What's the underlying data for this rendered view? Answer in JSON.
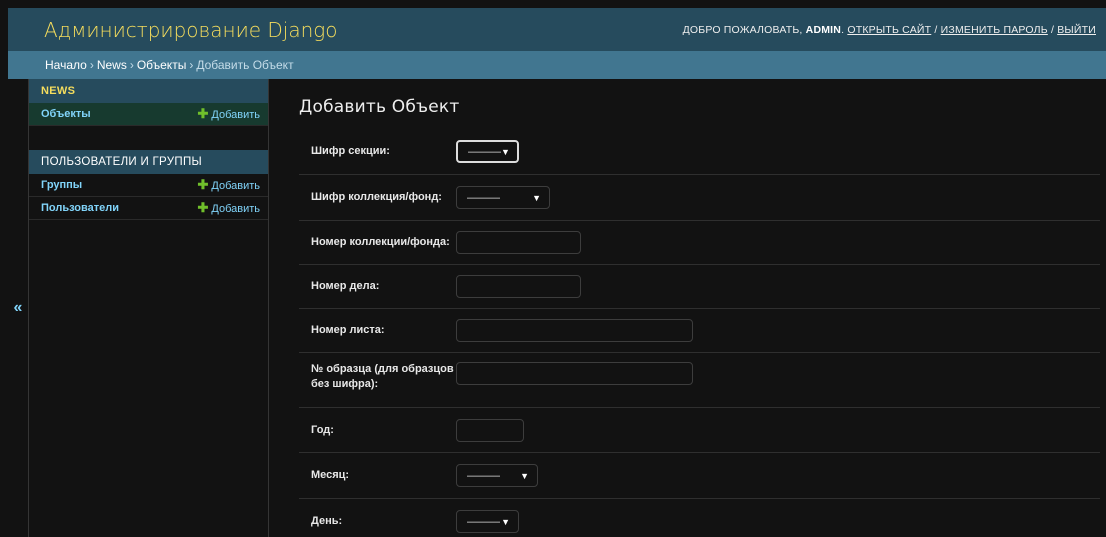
{
  "header": {
    "site_name": "Администрирование Django",
    "welcome": "ДОБРО ПОЖАЛОВАТЬ,",
    "username": "ADMIN",
    "links": [
      "ОТКРЫТЬ САЙТ",
      "ИЗМЕНИТЬ ПАРОЛЬ",
      "ВЫЙТИ"
    ],
    "separator": "/"
  },
  "breadcrumbs": {
    "items": [
      "Начало",
      "News",
      "Объекты"
    ],
    "current": "Добавить Объект",
    "separator": "›"
  },
  "sidebar": {
    "toggle": "«",
    "apps": [
      {
        "caption": "NEWS",
        "models": [
          {
            "name": "Объекты",
            "add": "Добавить"
          }
        ]
      },
      {
        "caption": "ПОЛЬЗОВАТЕЛИ И ГРУППЫ",
        "models": [
          {
            "name": "Группы",
            "add": "Добавить"
          },
          {
            "name": "Пользователи",
            "add": "Добавить"
          }
        ]
      }
    ]
  },
  "content": {
    "title": "Добавить Объект",
    "fields": [
      {
        "label": "Шифр секции:",
        "type": "select",
        "value": "———"
      },
      {
        "label": "Шифр коллекция/фонд:",
        "type": "select",
        "value": "———"
      },
      {
        "label": "Номер коллекции/фонда:",
        "type": "text",
        "value": ""
      },
      {
        "label": "Номер дела:",
        "type": "text",
        "value": ""
      },
      {
        "label": "Номер листа:",
        "type": "text",
        "value": ""
      },
      {
        "label": "№ образца (для образцов без шифра):",
        "type": "text",
        "value": ""
      },
      {
        "label": "Год:",
        "type": "text",
        "value": ""
      },
      {
        "label": "Месяц:",
        "type": "select",
        "value": "———"
      },
      {
        "label": "День:",
        "type": "select",
        "value": "———"
      }
    ]
  },
  "colors": {
    "header_bg": "#264b5d",
    "breadcrumbs_bg": "#417690",
    "accent_yellow": "#f5dd5d",
    "link_blue": "#81d4fa",
    "add_green": "#70bf2b",
    "body_bg": "#121212"
  },
  "icons": {
    "add": "plus-icon",
    "select_arrow": "chevron-down-icon",
    "collapse": "double-chevron-left-icon"
  }
}
